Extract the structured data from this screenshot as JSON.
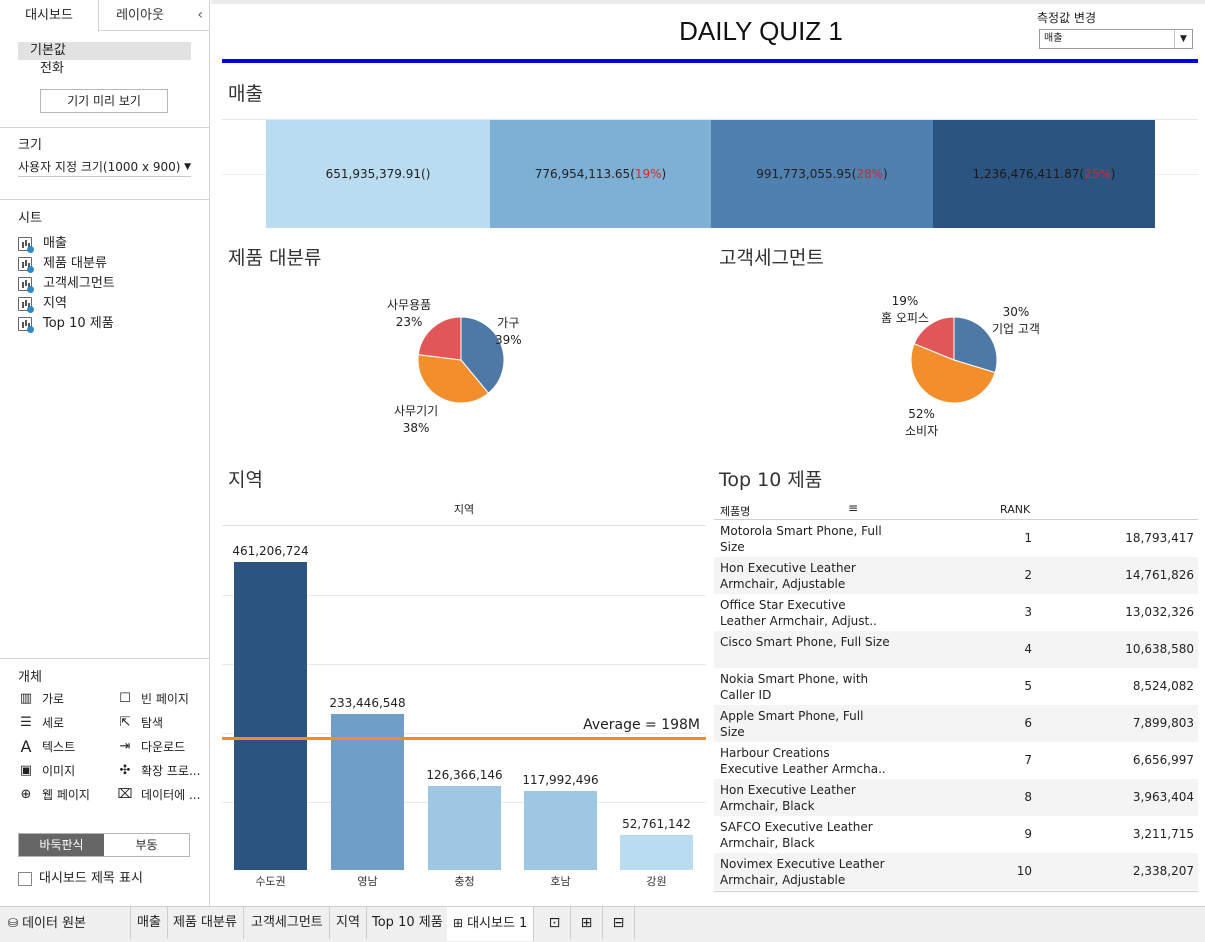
{
  "left_panel": {
    "tabs": [
      "대시보드",
      "레이아웃"
    ],
    "collapse": "‹",
    "device_items": [
      "기본값",
      "전화"
    ],
    "preview_button": "기기 미리 보기",
    "size_title": "크기",
    "size_value": "사용자 지정 크기(1000 x 900)",
    "sheets_title": "시트",
    "sheets": [
      "매출",
      "제품 대분류",
      "고객세그먼트",
      "지역",
      "Top 10 제품"
    ],
    "objects_title": "개체",
    "objects": [
      "가로",
      "빈 페이지",
      "세로",
      "탐색",
      "텍스트",
      "다운로드",
      "이미지",
      "확장 프로...",
      "웹 페이지",
      "데이터에 ..."
    ],
    "float_toggle": [
      "바둑판식",
      "부동"
    ],
    "show_title": "대시보드 제목 표시"
  },
  "dashboard": {
    "title": "DAILY QUIZ 1",
    "param_label": "측정값 변경",
    "param_value": "매출",
    "sales": {
      "title": "매출",
      "segments": [
        {
          "value": "651,935,379.91",
          "pct": "",
          "suffix": "()",
          "color": "#b9dcf0"
        },
        {
          "value": "776,954,113.65",
          "pct": "19%",
          "suffix": "",
          "color": "#7eb0d5"
        },
        {
          "value": "991,773,055.95",
          "pct": "28%",
          "suffix": "",
          "color": "#4e80b0"
        },
        {
          "value": "1,236,476,411.87",
          "pct": "25%",
          "suffix": "",
          "color": "#2b5580"
        }
      ]
    },
    "category_title": "제품 대분류",
    "category_labels": {
      "furniture": "가구\n39%",
      "office": "사무용품\n23%",
      "tech": "사무기기\n38%"
    },
    "segment_title": "고객세그먼트",
    "segment_labels": {
      "corp": "30%\n기업 고객",
      "home": "19%\n홈 오피스",
      "consumer": "52%\n소비자"
    },
    "region_title": "지역",
    "top10_title": "Top 10 제품",
    "colors": {
      "blue": "#4e79a7",
      "orange": "#f28e2b",
      "red": "#e15759",
      "avg": "#f28e1c"
    }
  },
  "chart_data": [
    {
      "type": "pie",
      "title": "제품 대분류",
      "labels": [
        "가구",
        "사무기기",
        "사무용품"
      ],
      "values": [
        39,
        38,
        23
      ],
      "colors": [
        "#4e79a7",
        "#f28e2b",
        "#e15759"
      ]
    },
    {
      "type": "pie",
      "title": "고객세그먼트",
      "labels": [
        "기업 고객",
        "소비자",
        "홈 오피스"
      ],
      "values": [
        30,
        52,
        19
      ],
      "colors": [
        "#4e79a7",
        "#f28e2b",
        "#e15759"
      ]
    },
    {
      "type": "bar",
      "title": "지역",
      "header": "지역",
      "categories": [
        "수도권",
        "영남",
        "충청",
        "호남",
        "강원"
      ],
      "values": [
        461206724,
        233446548,
        126366146,
        117992496,
        52761142
      ],
      "value_labels": [
        "461,206,724",
        "233,446,548",
        "126,366,146",
        "117,992,496",
        "52,761,142"
      ],
      "colors": [
        "#2b5580",
        "#6f9ec8",
        "#9ec7e3",
        "#9ec7e3",
        "#b9dcf0"
      ],
      "average": 198000000,
      "average_label": "Average = 198M",
      "ylim": [
        0,
        500000000
      ]
    },
    {
      "type": "table",
      "title": "Top 10 제품",
      "columns": [
        "제품명",
        "RANK",
        ""
      ],
      "rows": [
        {
          "name": "Motorola Smart Phone, Full Size",
          "rank": "1",
          "value": "18,793,417"
        },
        {
          "name": "Hon Executive Leather Armchair, Adjustable",
          "rank": "2",
          "value": "14,761,826"
        },
        {
          "name": "Office Star Executive Leather Armchair, Adjust..",
          "rank": "3",
          "value": "13,032,326"
        },
        {
          "name": "Cisco Smart Phone, Full Size",
          "rank": "4",
          "value": "10,638,580"
        },
        {
          "name": "Nokia Smart Phone, with Caller ID",
          "rank": "5",
          "value": "8,524,082"
        },
        {
          "name": "Apple Smart Phone, Full Size",
          "rank": "6",
          "value": "7,899,803"
        },
        {
          "name": "Harbour Creations Executive Leather Armcha..",
          "rank": "7",
          "value": "6,656,997"
        },
        {
          "name": "Hon Executive Leather Armchair, Black",
          "rank": "8",
          "value": "3,963,404"
        },
        {
          "name": "SAFCO Executive Leather Armchair, Black",
          "rank": "9",
          "value": "3,211,715"
        },
        {
          "name": "Novimex Executive Leather Armchair, Adjustable",
          "rank": "10",
          "value": "2,338,207"
        }
      ]
    }
  ],
  "bottom_tabs": {
    "source": "데이터 원본",
    "sheets": [
      "매출",
      "제품 대분류",
      "고객세그먼트",
      "지역",
      "Top 10 제품"
    ],
    "active": "대시보드 1"
  }
}
